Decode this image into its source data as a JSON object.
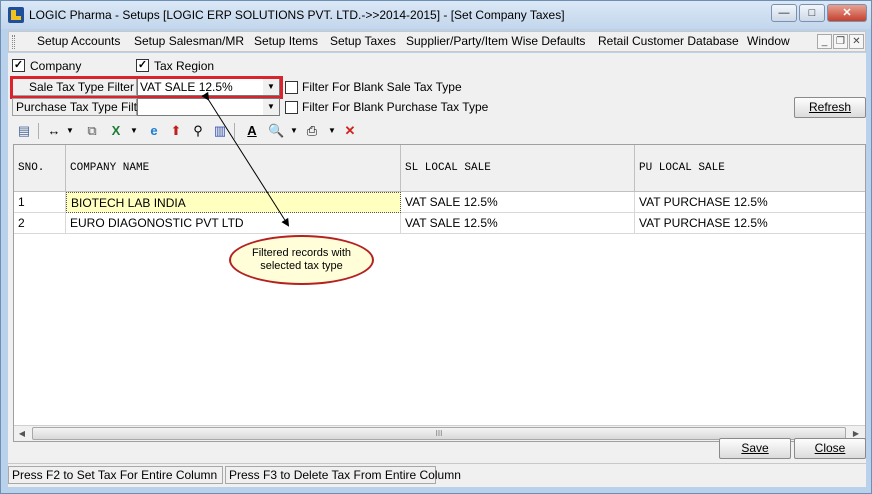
{
  "window": {
    "title": "LOGIC Pharma - Setups  [LOGIC ERP SOLUTIONS PVT. LTD.->>2014-2015] - [Set Company Taxes]",
    "minimize_glyph": "—",
    "maximize_glyph": "□",
    "close_glyph": "✕"
  },
  "menu": {
    "items": [
      {
        "label": "Setup Accounts"
      },
      {
        "label": "Setup Salesman/MR"
      },
      {
        "label": "Setup Items"
      },
      {
        "label": "Setup Taxes"
      },
      {
        "label": "Supplier/Party/Item Wise Defaults"
      },
      {
        "label": "Retail Customer Database"
      },
      {
        "label": "Window"
      }
    ],
    "mdi_minimize": "_",
    "mdi_restore": "❐",
    "mdi_close": "✕"
  },
  "options": {
    "company_label": "Company",
    "company_checked": true,
    "tax_region_label": "Tax Region",
    "tax_region_checked": true,
    "check_glyph": "✓"
  },
  "filters": {
    "sale_label": "Sale Tax Type Filter",
    "sale_value": "VAT SALE 12.5%",
    "blank_sale_label": "Filter For Blank Sale Tax Type",
    "purchase_label": "Purchase Tax Type Filter",
    "purchase_value": "",
    "blank_purchase_label": "Filter For Blank Purchase Tax Type",
    "combo_arrow": "▼"
  },
  "refresh_label": "Refresh",
  "toolbar_icons": [
    "column-chooser-icon",
    "move-icon",
    "copy-icon",
    "excel-icon",
    "internet-explorer-icon",
    "upload-icon",
    "find-icon",
    "chart-icon",
    "text-format-icon",
    "print-preview-icon",
    "print-icon",
    "delete-icon"
  ],
  "grid": {
    "columns": [
      "SNO.",
      "COMPANY NAME",
      "SL LOCAL SALE",
      "PU LOCAL SALE"
    ],
    "rows": [
      {
        "sno": "1",
        "company": "BIOTECH LAB INDIA",
        "sl": "VAT SALE 12.5%",
        "pu": "VAT PURCHASE 12.5%"
      },
      {
        "sno": "2",
        "company": "EURO DIAGONOSTIC PVT LTD",
        "sl": "VAT SALE 12.5%",
        "pu": "VAT PURCHASE 12.5%"
      }
    ],
    "scroll_grip": "III"
  },
  "callout_text": "Filtered records with selected tax type",
  "buttons": {
    "save": "Save",
    "close": "Close"
  },
  "status": {
    "f2": "Press F2 to Set Tax For Entire Column",
    "f3": "Press F3 to Delete Tax From Entire Column"
  },
  "colors": {
    "highlight": "#d9232d",
    "callout_fill": "#fffed8",
    "selected_cell": "#ffffc0"
  }
}
